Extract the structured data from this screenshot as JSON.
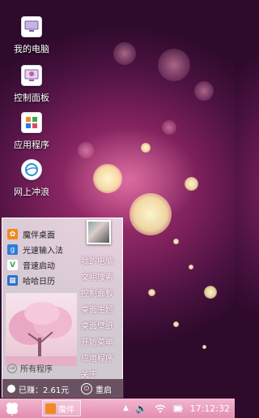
{
  "desktop": {
    "icons": [
      {
        "label": "我的电脑",
        "icon": "computer-icon"
      },
      {
        "label": "控制面板",
        "icon": "control-panel-icon"
      },
      {
        "label": "应用程序",
        "icon": "applications-icon"
      },
      {
        "label": "网上冲浪",
        "icon": "browser-icon"
      }
    ]
  },
  "start_menu": {
    "pinned": [
      {
        "label": "魔伴桌面",
        "icon": "mobile-desktop-icon",
        "color": "#f08a24"
      },
      {
        "label": "光速输入法",
        "icon": "input-method-icon",
        "color": "#2f7cd8"
      },
      {
        "label": "音速启动",
        "icon": "launcher-icon",
        "color": "#3fa64a"
      },
      {
        "label": "哈哈日历",
        "icon": "calendar-icon",
        "color": "#2f6fc8"
      }
    ],
    "all_programs": "所有程序",
    "right_items": [
      "我的电脑",
      "文明搜索",
      "控制面板",
      "桌面主题",
      "桌面壁纸",
      "开始菜单",
      "应用程序",
      "关于"
    ],
    "earned": "已赚：2.61元",
    "restart": "重启"
  },
  "taskbar": {
    "task_label": "魔伴",
    "time": "17:12:32"
  },
  "colors": {
    "taskbar": "#e38db3",
    "wallpaper": "#7a1f5a"
  }
}
